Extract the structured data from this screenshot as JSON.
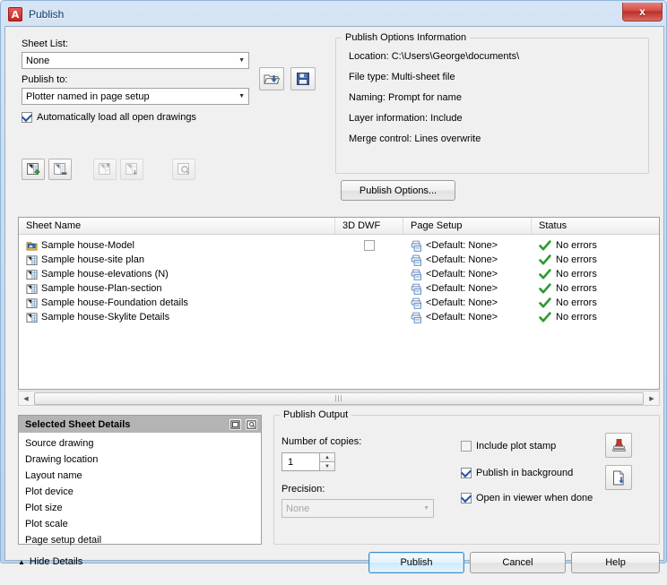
{
  "window": {
    "title": "Publish",
    "logo_letter": "A",
    "close_label": "x"
  },
  "sheet_list_section": {
    "sheet_list_label": "Sheet List:",
    "sheet_list_value": "None",
    "publish_to_label": "Publish to:",
    "publish_to_value": "Plotter named in page setup",
    "auto_load_label": "Automatically load all open drawings",
    "auto_load_checked": true,
    "load_button_name": "load-sheet-list-button",
    "save_button_name": "save-sheet-list-button"
  },
  "toolbar": {
    "buttons": [
      {
        "name": "add-sheets-button",
        "enabled": true
      },
      {
        "name": "remove-sheets-button",
        "enabled": true
      },
      {
        "name": "move-sheet-up-button",
        "enabled": false
      },
      {
        "name": "move-sheet-down-button",
        "enabled": false
      },
      {
        "name": "preview-button",
        "enabled": false
      }
    ]
  },
  "publish_options_info": {
    "group_title": "Publish Options Information",
    "lines": [
      "Location: C:\\Users\\George\\documents\\",
      "File type: Multi-sheet file",
      "Naming: Prompt for name",
      "Layer information: Include",
      "Merge control: Lines overwrite"
    ],
    "options_button": "Publish Options..."
  },
  "sheet_table": {
    "columns": [
      "Sheet Name",
      "3D DWF",
      "Page Setup",
      "Status"
    ],
    "rows": [
      {
        "name": "Sample house-Model",
        "icon": "model-tab-icon",
        "dwf_visible": true,
        "dwf_checked": false,
        "page_setup": "<Default: None>",
        "status": "No errors"
      },
      {
        "name": "Sample house-site plan",
        "icon": "layout-tab-icon",
        "dwf_visible": false,
        "dwf_checked": false,
        "page_setup": "<Default: None>",
        "status": "No errors"
      },
      {
        "name": "Sample house-elevations (N)",
        "icon": "layout-tab-icon",
        "dwf_visible": false,
        "dwf_checked": false,
        "page_setup": "<Default: None>",
        "status": "No errors"
      },
      {
        "name": "Sample house-Plan-section",
        "icon": "layout-tab-icon",
        "dwf_visible": false,
        "dwf_checked": false,
        "page_setup": "<Default: None>",
        "status": "No errors"
      },
      {
        "name": "Sample house-Foundation details",
        "icon": "layout-tab-icon",
        "dwf_visible": false,
        "dwf_checked": false,
        "page_setup": "<Default: None>",
        "status": "No errors"
      },
      {
        "name": "Sample house-Skylite Details",
        "icon": "layout-tab-icon",
        "dwf_visible": false,
        "dwf_checked": false,
        "page_setup": "<Default: None>",
        "status": "No errors"
      }
    ]
  },
  "selected_sheet_details": {
    "title": "Selected Sheet Details",
    "rows": [
      "Source drawing",
      "Drawing location",
      "Layout name",
      "Plot device",
      "Plot size",
      "Plot scale",
      "Page setup detail"
    ]
  },
  "publish_output": {
    "group_title": "Publish Output",
    "copies_label": "Number of copies:",
    "copies_value": "1",
    "precision_label": "Precision:",
    "precision_value": "None",
    "precision_enabled": false,
    "checkboxes": [
      {
        "label": "Include plot stamp",
        "checked": false,
        "name": "include-plot-stamp-checkbox"
      },
      {
        "label": "Publish in background",
        "checked": true,
        "name": "publish-in-background-checkbox"
      },
      {
        "label": "Open in viewer when done",
        "checked": true,
        "name": "open-in-viewer-checkbox"
      }
    ],
    "plot_stamp_settings_name": "plot-stamp-settings-button",
    "publish_to_file_name": "publish-to-file-button"
  },
  "footer": {
    "hide_details": "Hide Details",
    "publish": "Publish",
    "cancel": "Cancel",
    "help": "Help"
  },
  "colors": {
    "title_bar_start": "#d6e4f5",
    "close_button": "#c5261f",
    "status_ok": "#2d9b2d",
    "details_header": "#b4b4b4",
    "default_button_border": "#3c8ec4"
  }
}
